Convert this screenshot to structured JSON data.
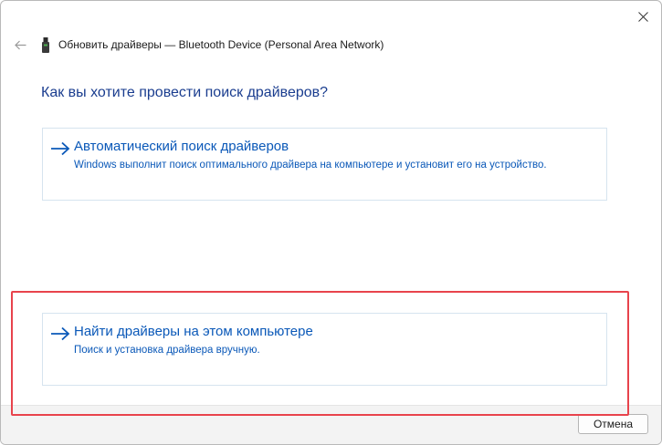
{
  "window": {
    "title": "Обновить драйверы — Bluetooth Device (Personal Area Network)",
    "close_icon": "close-icon",
    "back_icon": "back-arrow-icon",
    "device_icon": "usb-device-icon"
  },
  "main": {
    "heading": "Как вы хотите провести поиск драйверов?",
    "options": [
      {
        "title": "Автоматический поиск драйверов",
        "description": "Windows выполнит поиск оптимального драйвера на компьютере и установит его на устройство.",
        "icon": "right-arrow-icon"
      },
      {
        "title": "Найти драйверы на этом компьютере",
        "description": "Поиск и установка драйвера вручную.",
        "icon": "right-arrow-icon"
      }
    ]
  },
  "footer": {
    "cancel_label": "Отмена"
  },
  "colors": {
    "accent": "#0a58b8",
    "heading": "#1a3d8f",
    "highlight": "#e8434c",
    "option_border": "#d6e4ef"
  }
}
